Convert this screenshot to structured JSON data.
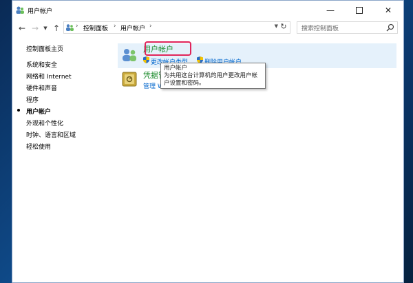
{
  "window": {
    "title": "用户帐户"
  },
  "address": {
    "crumbs": [
      "控制面板",
      "用户帐户"
    ],
    "search_placeholder": "搜索控制面板"
  },
  "sidebar": {
    "home": "控制面板主页",
    "items": [
      {
        "label": "系统和安全"
      },
      {
        "label": "网络和 Internet"
      },
      {
        "label": "硬件和声音"
      },
      {
        "label": "程序"
      },
      {
        "label": "用户帐户",
        "selected": true
      },
      {
        "label": "外观和个性化"
      },
      {
        "label": "时钟、语言和区域"
      },
      {
        "label": "轻松使用"
      }
    ]
  },
  "categories": [
    {
      "title": "用户帐户",
      "links": [
        "更改帐户类型",
        "删除用户帐户"
      ],
      "icon": "users-icon"
    },
    {
      "title": "凭据管理器",
      "links": [
        "管理 Web 凭据"
      ],
      "icon": "safe-icon"
    }
  ],
  "tooltip": {
    "title": "用户帐户",
    "body_line1": "为共用这台计算机的用户更改用户帐",
    "body_line2": "户设置和密码。"
  },
  "colors": {
    "category_title": "#1a8a2a",
    "link": "#0066cc",
    "highlight_band": "#e5f1fb",
    "annotation_box": "#e0245a"
  }
}
